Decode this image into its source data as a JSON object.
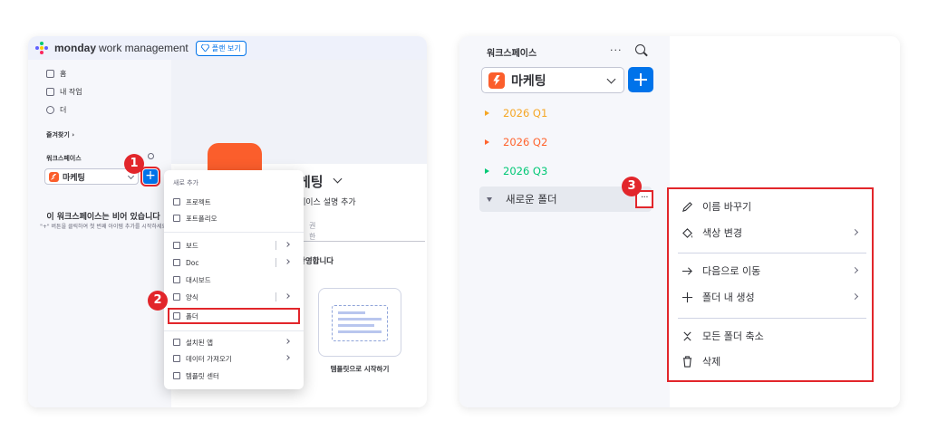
{
  "left": {
    "brand_strong": "monday",
    "brand_light": "work management",
    "plan_button": "플랜 보기",
    "nav": [
      {
        "label": "홈",
        "icon": "home-icon"
      },
      {
        "label": "내 작업",
        "icon": "my-work-icon"
      },
      {
        "label": "더",
        "icon": "more-circle-icon"
      }
    ],
    "favorites": "즐겨찾기 ›",
    "workspace_section": "워크스페이스",
    "workspace_name": "마케팅",
    "empty_title": "이 워크스페이스는 비어 있습니다",
    "empty_sub": "\"+\" 버튼을 클릭하여 첫 번째 아이템 추가를 시작하세요",
    "board_title": "케팅",
    "board_desc": "페이스 설명 추가",
    "perm_line1": "권",
    "perm_line2": "한",
    "welcome": "환영합니다",
    "template_label": "템플릿으로 시작하기",
    "dropdown": {
      "header": "새로 추가",
      "items": [
        {
          "label": "프로젝트",
          "icon": "project-icon",
          "submenu": false
        },
        {
          "label": "포트폴리오",
          "icon": "portfolio-icon",
          "submenu": false
        },
        {
          "label": "보드",
          "icon": "board-icon",
          "submenu": true
        },
        {
          "label": "Doc",
          "icon": "doc-icon",
          "submenu": true
        },
        {
          "label": "대시보드",
          "icon": "dashboard-icon",
          "submenu": false
        },
        {
          "label": "양식",
          "icon": "form-icon",
          "submenu": true
        },
        {
          "label": "폴더",
          "icon": "folder-icon",
          "submenu": false
        },
        {
          "label": "설치된 앱",
          "icon": "apps-icon",
          "submenu": true
        },
        {
          "label": "데이터 가져오기",
          "icon": "import-icon",
          "submenu": true
        },
        {
          "label": "템플릿 센터",
          "icon": "template-center-icon",
          "submenu": false
        }
      ]
    }
  },
  "right": {
    "workspace_label": "워크스페이스",
    "workspace_name": "마케팅",
    "more_dots": "···",
    "quarters": [
      {
        "label": "2026 Q1",
        "color": "#f5a623"
      },
      {
        "label": "2026 Q2",
        "color": "#ff642e"
      },
      {
        "label": "2026 Q3",
        "color": "#00c875"
      }
    ],
    "folder_name": "새로운 폴더",
    "context_menu": [
      {
        "label": "이름 바꾸기",
        "icon": "pencil-icon",
        "submenu": false
      },
      {
        "label": "색상 변경",
        "icon": "paint-bucket-icon",
        "submenu": true
      },
      {
        "label": "다음으로 이동",
        "icon": "arrow-right-icon",
        "submenu": true
      },
      {
        "label": "폴더 내 생성",
        "icon": "plus-icon",
        "submenu": true
      },
      {
        "label": "모든 폴더 축소",
        "icon": "collapse-icon",
        "submenu": false
      },
      {
        "label": "삭제",
        "icon": "trash-icon",
        "submenu": false
      }
    ]
  },
  "badges": [
    "1",
    "2",
    "3"
  ],
  "colors": {
    "accent": "#0073ea",
    "highlight": "#e2262b",
    "workspace": "#fb5e2c"
  }
}
